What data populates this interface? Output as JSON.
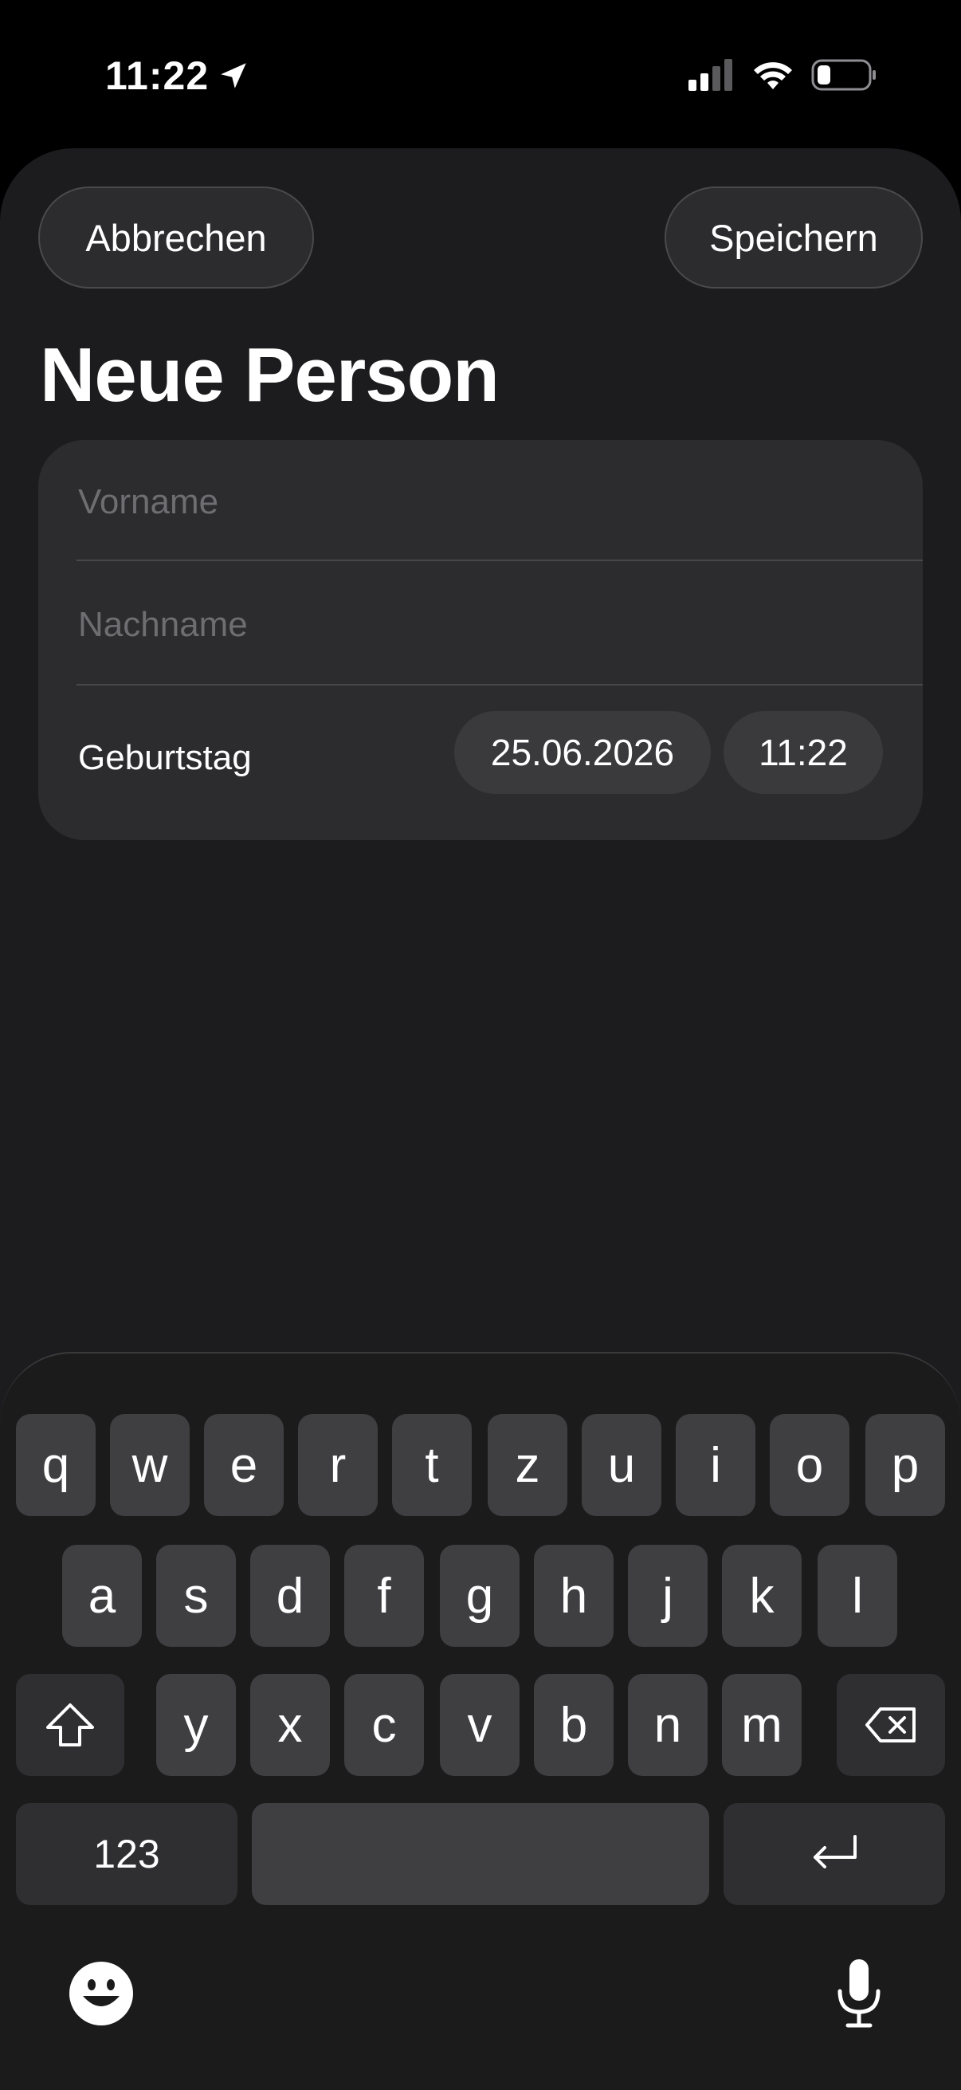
{
  "status_bar": {
    "time": "11:22",
    "icons": [
      "location-arrow-icon",
      "cellular-signal-icon",
      "wifi-icon",
      "battery-icon"
    ]
  },
  "header": {
    "cancel_label": "Abbrechen",
    "save_label": "Speichern",
    "title": "Neue Person"
  },
  "form": {
    "first_name": {
      "value": "",
      "placeholder": "Vorname"
    },
    "last_name": {
      "value": "",
      "placeholder": "Nachname"
    },
    "birthday_label": "Geburtstag",
    "birthday_date": "25.06.2026",
    "birthday_time": "11:22"
  },
  "keyboard": {
    "row1": [
      "q",
      "w",
      "e",
      "r",
      "t",
      "z",
      "u",
      "i",
      "o",
      "p"
    ],
    "row2": [
      "a",
      "s",
      "d",
      "f",
      "g",
      "h",
      "j",
      "k",
      "l"
    ],
    "row3": [
      "y",
      "x",
      "c",
      "v",
      "b",
      "n",
      "m"
    ],
    "numbers_label": "123",
    "space_label": "",
    "icons": [
      "shift-icon",
      "delete-icon",
      "return-icon",
      "emoji-icon",
      "microphone-icon"
    ]
  },
  "colors": {
    "background": "#1c1c1e",
    "card": "#2c2c2e",
    "key": "#3f3f41",
    "placeholder": "#6d6d72"
  }
}
